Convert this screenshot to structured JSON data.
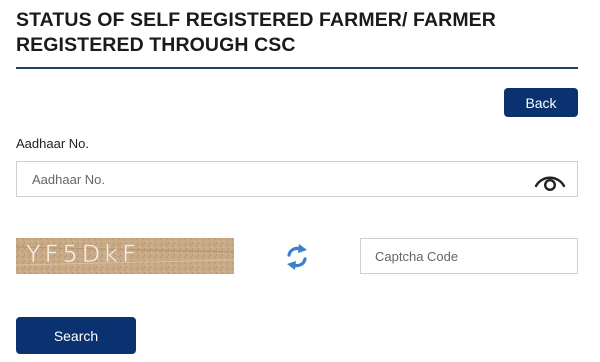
{
  "header": {
    "title": "STATUS OF SELF REGISTERED FARMER/ FARMER REGISTERED THROUGH CSC",
    "rule_color": "#1e3f66"
  },
  "actions": {
    "back_label": "Back",
    "search_label": "Search",
    "button_color": "#0a3270"
  },
  "aadhaar": {
    "label": "Aadhaar No.",
    "placeholder": "Aadhaar No.",
    "value": "",
    "toggle_icon": "eye-icon"
  },
  "captcha": {
    "image_text": "YF5DkF",
    "refresh_icon": "refresh-icon",
    "placeholder": "Captcha Code",
    "value": ""
  }
}
